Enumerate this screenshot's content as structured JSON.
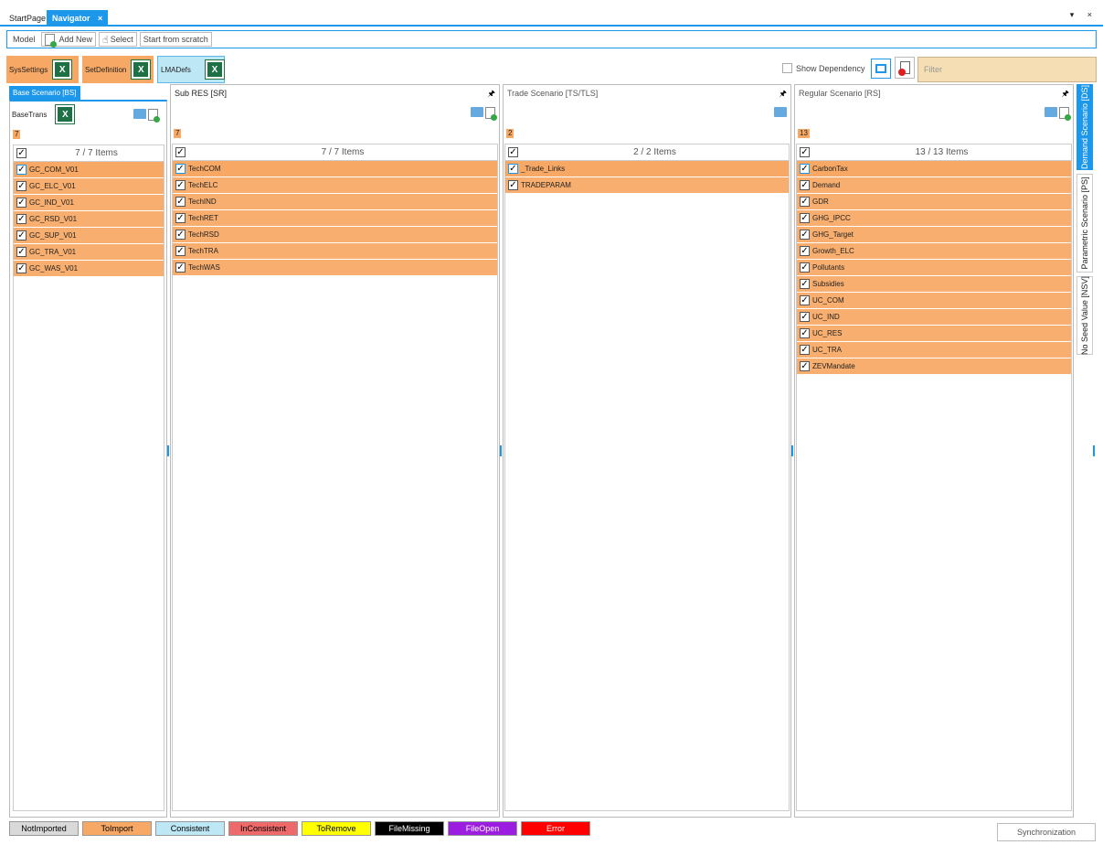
{
  "tabs": [
    {
      "label": "StartPage"
    },
    {
      "label": "Navigator",
      "close": "×"
    }
  ],
  "window_controls": "▾ ×",
  "toolbar": {
    "model_label": "Model",
    "add_new": "Add New",
    "select": "Select",
    "start_from_scratch": "Start from scratch"
  },
  "settings": {
    "sys": "SysSettings",
    "setdef": "SetDefinition",
    "lma": "LMADefs",
    "excel_glyph": "X"
  },
  "right_tools": {
    "show_dependency": "Show Dependency",
    "filter_placeholder": "Filter"
  },
  "base": {
    "tab": "Base Scenario [BS]",
    "trans": "BaseTrans",
    "count": "7",
    "header": "7 / 7 Items",
    "items": [
      "GC_COM_V01",
      "GC_ELC_V01",
      "GC_IND_V01",
      "GC_RSD_V01",
      "GC_SUP_V01",
      "GC_TRA_V01",
      "GC_WAS_V01"
    ]
  },
  "sub": {
    "title": "Sub RES [SR]",
    "count": "7",
    "header": "7 / 7 Items",
    "items": [
      "TechCOM",
      "TechELC",
      "TechIND",
      "TechRET",
      "TechRSD",
      "TechTRA",
      "TechWAS"
    ]
  },
  "trade": {
    "title": "Trade Scenario [TS/TLS]",
    "count": "2",
    "header": "2 / 2 Items",
    "items": [
      "_Trade_Links",
      "TRADEPARAM"
    ]
  },
  "regular": {
    "title": "Regular Scenario [RS]",
    "count": "13",
    "header": "13 / 13 Items",
    "items": [
      "CarbonTax",
      "Demand",
      "GDR",
      "GHG_IPCC",
      "GHG_Target",
      "Growth_ELC",
      "Pollutants",
      "Subsidies",
      "UC_COM",
      "UC_IND",
      "UC_RES",
      "UC_TRA",
      "ZEVMandate"
    ]
  },
  "vertical_tabs": [
    "Demand Scenario [DS]",
    "Parametric Scenario [PS]",
    "No Seed Value [NSV]"
  ],
  "legend": [
    {
      "label": "NotImported",
      "bg": "#d9d9d9",
      "fg": "#000"
    },
    {
      "label": "ToImport",
      "bg": "#f7a864",
      "fg": "#000"
    },
    {
      "label": "Consistent",
      "bg": "#bde7f5",
      "fg": "#000"
    },
    {
      "label": "InConsistent",
      "bg": "#ee6a6a",
      "fg": "#000"
    },
    {
      "label": "ToRemove",
      "bg": "#ffff00",
      "fg": "#000"
    },
    {
      "label": "FileMissing",
      "bg": "#000000",
      "fg": "#fff"
    },
    {
      "label": "FileOpen",
      "bg": "#9b1ee0",
      "fg": "#fff"
    },
    {
      "label": "Error",
      "bg": "#ff0000",
      "fg": "#fff"
    }
  ],
  "sync_label": "Synchronization",
  "colors": {
    "accent": "#1c97ea",
    "to_import": "#f7a864"
  },
  "check": "✓",
  "pin": "📌"
}
